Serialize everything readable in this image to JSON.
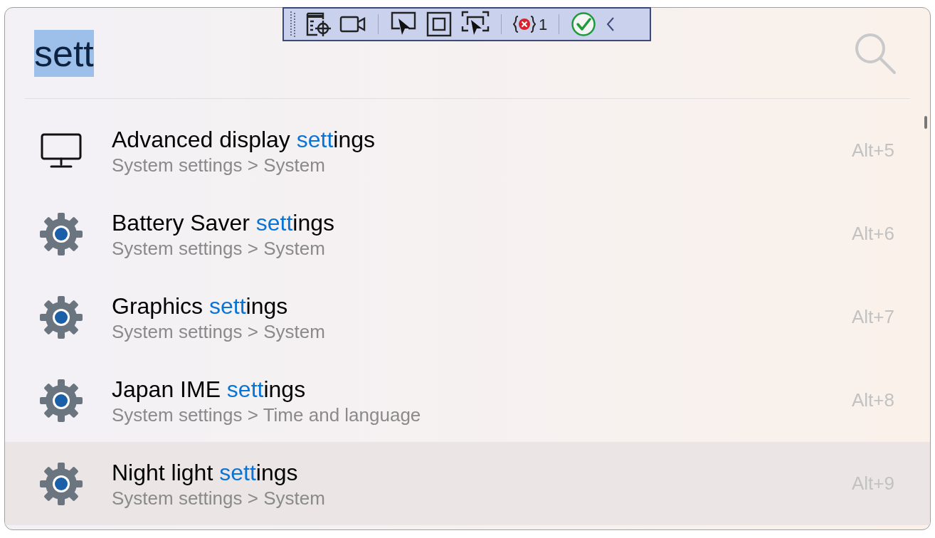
{
  "search": {
    "value": "sett",
    "selected_text": true
  },
  "toolbar": {
    "error_count": "1"
  },
  "results": [
    {
      "kind": "monitor",
      "title_before": "Advanced display ",
      "title_match": "sett",
      "title_after": "ings",
      "subtitle": "System settings > System",
      "shortcut": "Alt+5",
      "selected": false
    },
    {
      "kind": "gear",
      "title_before": "Battery Saver ",
      "title_match": "sett",
      "title_after": "ings",
      "subtitle": "System settings > System",
      "shortcut": "Alt+6",
      "selected": false
    },
    {
      "kind": "gear",
      "title_before": "Graphics ",
      "title_match": "sett",
      "title_after": "ings",
      "subtitle": "System settings > System",
      "shortcut": "Alt+7",
      "selected": false
    },
    {
      "kind": "gear",
      "title_before": "Japan IME ",
      "title_match": "sett",
      "title_after": "ings",
      "subtitle": "System settings > Time and language",
      "shortcut": "Alt+8",
      "selected": false
    },
    {
      "kind": "gear",
      "title_before": "Night light ",
      "title_match": "sett",
      "title_after": "ings",
      "subtitle": "System settings > System",
      "shortcut": "Alt+9",
      "selected": true
    }
  ]
}
